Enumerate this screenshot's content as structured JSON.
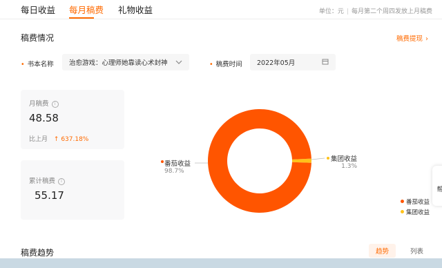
{
  "tabs": [
    {
      "label": "每日收益"
    },
    {
      "label": "每月稿费"
    },
    {
      "label": "礼物收益"
    }
  ],
  "note": {
    "unit": "单位：元",
    "schedule": "每月第二个周四发放上月稿费"
  },
  "section": {
    "title": "稿费情况",
    "link": "稿费提现"
  },
  "filters": {
    "book_label": "书本名称",
    "book_value": "治愈游戏：心理师她靠读心术封神",
    "time_label": "稿费时间",
    "time_value": "2022年05月"
  },
  "monthly": {
    "label": "月稿费",
    "value": "48.58",
    "compare_label": "比上月",
    "compare_value": "637.18%"
  },
  "total": {
    "label": "累计稿费",
    "value": "55.17"
  },
  "chart_data": {
    "type": "pie",
    "donut": true,
    "slices": [
      {
        "name": "番茄收益",
        "value": 98.7,
        "label": "98.7%",
        "color": "#ff5500"
      },
      {
        "name": "集团收益",
        "value": 1.3,
        "label": "1.3%",
        "color": "#ffc21a"
      }
    ],
    "legend": [
      "番茄收益",
      "集团收益"
    ],
    "legend_position": "bottom-right"
  },
  "help": {
    "label": "帮"
  },
  "trend": {
    "title": "稿费趋势",
    "toggle_on": "趋势",
    "toggle_off": "列表"
  }
}
